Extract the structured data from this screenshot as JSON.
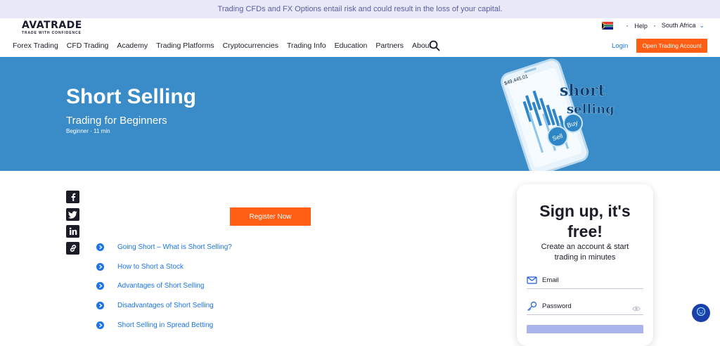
{
  "risk_notice": "Trading CFDs and FX Options entail risk and could result in the loss of your capital.",
  "logo": {
    "main": "AVATRADE",
    "tagline": "TRADE WITH CONFIDENCE"
  },
  "util": {
    "help": "Help",
    "region": "South Africa",
    "flag_icon": "south-africa-flag-icon"
  },
  "nav": {
    "items": [
      "Forex Trading",
      "CFD Trading",
      "Academy",
      "Trading Platforms",
      "Cryptocurrencies",
      "Trading Info",
      "Education",
      "Partners",
      "About"
    ],
    "login": "Login",
    "open_account": "Open Trading Account"
  },
  "hero": {
    "title": "Short Selling",
    "subtitle": "Trading for Beginners",
    "level": "Beginner",
    "duration": "11 min",
    "art": {
      "balance": "$49,445.01",
      "word1": "short",
      "word2": "selling",
      "buy": "Buy",
      "sell": "Sell"
    }
  },
  "share_icons": [
    "facebook-icon",
    "twitter-icon",
    "linkedin-icon",
    "copy-link-icon"
  ],
  "register_label": "Register Now",
  "toc": [
    "Going Short – What is Short Selling?",
    "How to Short a Stock",
    "Advantages of Short Selling",
    "Disadvantages of Short Selling",
    "Short Selling in Spread Betting"
  ],
  "signup": {
    "title_line1": "Sign up, it's",
    "title_line2": "free!",
    "sub_line1": "Create an account & start",
    "sub_line2": "trading in minutes",
    "email_placeholder": "Email",
    "password_placeholder": "Password"
  },
  "colors": {
    "accent_orange": "#ff5e14",
    "hero_blue": "#3a8cc8",
    "link_blue": "#1a73e8",
    "risk_bar": "#e8e8f6"
  }
}
